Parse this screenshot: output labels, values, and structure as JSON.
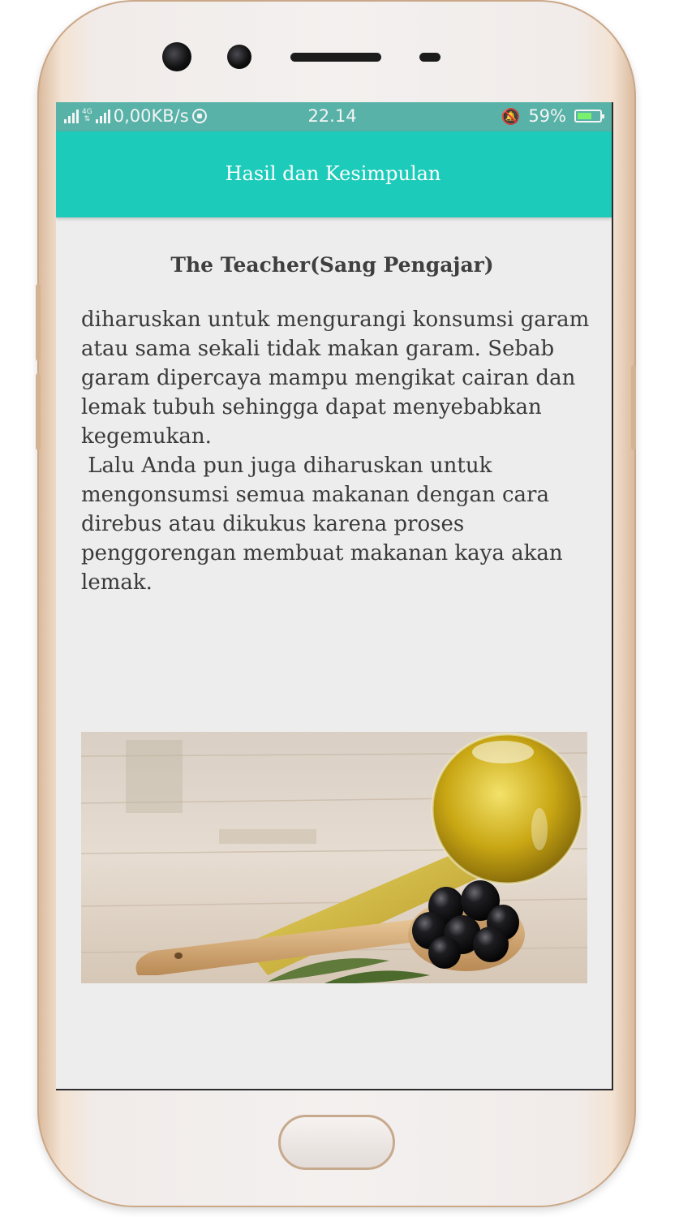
{
  "status_bar": {
    "network_speed": "0,00KB/s",
    "network_type": "4G",
    "time": "22.14",
    "battery_percent": "59%",
    "battery_level": 0.59,
    "battery_charging": true
  },
  "app_bar": {
    "title": "Hasil dan Kesimpulan"
  },
  "content": {
    "title": "The Teacher(Sang Pengajar)",
    "body": "diharuskan untuk mengurangi konsumsi garam atau sama sekali tidak makan garam. Sebab garam dipercaya mampu mengikat cairan dan lemak tubuh sehingga dapat menyebabkan kegemukan.\n Lalu Anda pun juga diharuskan untuk mengonsumsi semua makanan dengan cara direbus atau dikukus karena proses penggorengan membuat makanan kaya akan lemak."
  },
  "colors": {
    "status_bar": "#58b2a8",
    "app_bar": "#1ccbb9",
    "screen_background": "#ededed",
    "phone_frame": "#f3f0ef",
    "phone_trim": "#d4b393"
  }
}
